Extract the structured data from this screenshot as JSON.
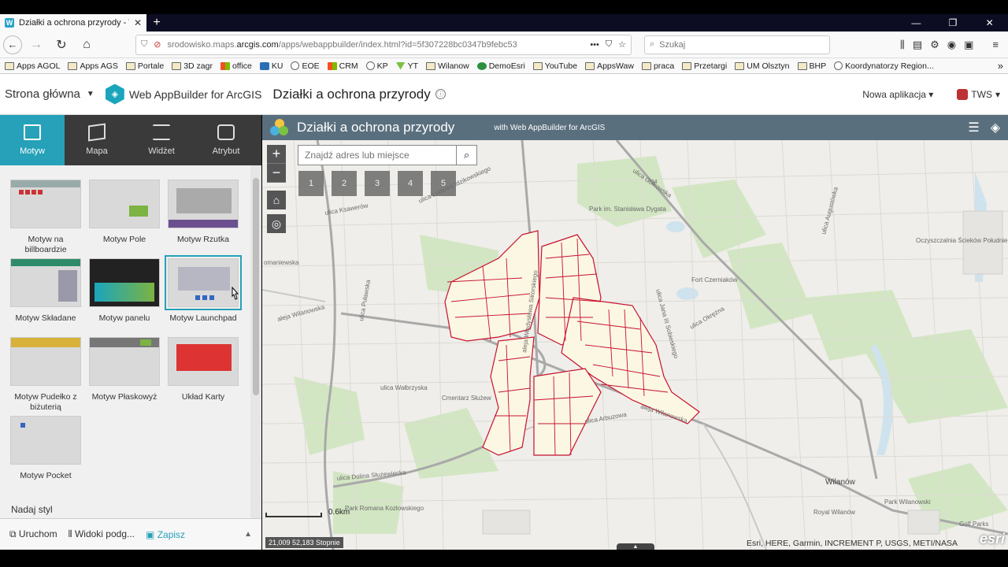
{
  "browser": {
    "tab_title": "Działki a ochrona przyrody - W",
    "url_prefix": "srodowisko.maps.",
    "url_domain": "arcgis.com",
    "url_rest": "/apps/webappbuilder/index.html?id=5f307228bc0347b9febc53",
    "search_placeholder": "Szukaj",
    "bookmarks": [
      "Apps AGOL",
      "Apps AGS",
      "Portale",
      "3D zagr",
      "office",
      "KU",
      "EOE",
      "CRM",
      "KP",
      "YT",
      "Wilanow",
      "DemoEsri",
      "YouTube",
      "AppsWaw",
      "praca",
      "Przetargi",
      "UM Olsztyn",
      "BHP",
      "Koordynatorzy Region..."
    ]
  },
  "app_header": {
    "home": "Strona główna",
    "product": "Web AppBuilder for ArcGIS",
    "app_title": "Działki a ochrona przyrody",
    "new_app": "Nowa aplikacja",
    "user": "TWS"
  },
  "left_panel": {
    "tabs": [
      "Motyw",
      "Mapa",
      "Widżet",
      "Atrybut"
    ],
    "themes": [
      {
        "label": "Motyw na billboardzie"
      },
      {
        "label": "Motyw Pole"
      },
      {
        "label": "Motyw Rzutka"
      },
      {
        "label": "Motyw Składane"
      },
      {
        "label": "Motyw panelu"
      },
      {
        "label": "Motyw Launchpad"
      },
      {
        "label": "Motyw Pudełko z biżuterią"
      },
      {
        "label": "Motyw Płaskowyż"
      },
      {
        "label": "Układ Karty"
      },
      {
        "label": "Motyw Pocket"
      }
    ],
    "style_heading": "Nadaj styl",
    "footer": {
      "run": "Uruchom",
      "views": "Widoki podg...",
      "save": "Zapisz"
    }
  },
  "map": {
    "title": "Działki a ochrona przyrody",
    "subtitle": "with Web AppBuilder for ArcGIS",
    "search_placeholder": "Znajdź adres lub miejsce",
    "bookmark_numbers": [
      "1",
      "2",
      "3",
      "4",
      "5"
    ],
    "scale_label": "0.6km",
    "coords": "21,009 52,183 Stopnie",
    "attribution": "Esri, HERE, Garmin, INCREMENT P, USGS, METI/NASA",
    "esri_logo": "esri",
    "labels": {
      "golkowska": "ulica Gołkowska",
      "pulawska": "ulica Puławska",
      "ksawerow": "ulica Ksawerów",
      "wilanowska": "aleja Wilanowska",
      "wilanowska2": "aleja Wilanowska",
      "sobieskiego": "ulica Jana III Sobieskiego",
      "rolna": "ulica Rolna",
      "dolina": "ulica Dolina Służewiecka",
      "walbrzyska": "ulica Wałbrzyska",
      "cmentarz": "Cmentarz Służew",
      "park_dygata": "Park im. Stanisława Dygata",
      "fort": "Fort Czerniaków",
      "wilanow": "Wilanów",
      "park_romana": "Park Romana Kozłowskiego",
      "royal": "Royal Wilanów",
      "park_wilanowski": "Park Wilanowski",
      "oczyszczalnia": "Oczyszczalnia Ścieków Południe",
      "idzikowskiego": "ulica Ludwika Idzikowskiego",
      "arbuzowa": "ulica Arbuzowa",
      "okrezna": "ulica Okrężna",
      "golf": "Golf Parks",
      "romanowska": "omaniewska",
      "sikorskiego": "aleja Władysława Sikorskiego",
      "augustowka": "ulica Augustówka",
      "route": "724"
    }
  }
}
